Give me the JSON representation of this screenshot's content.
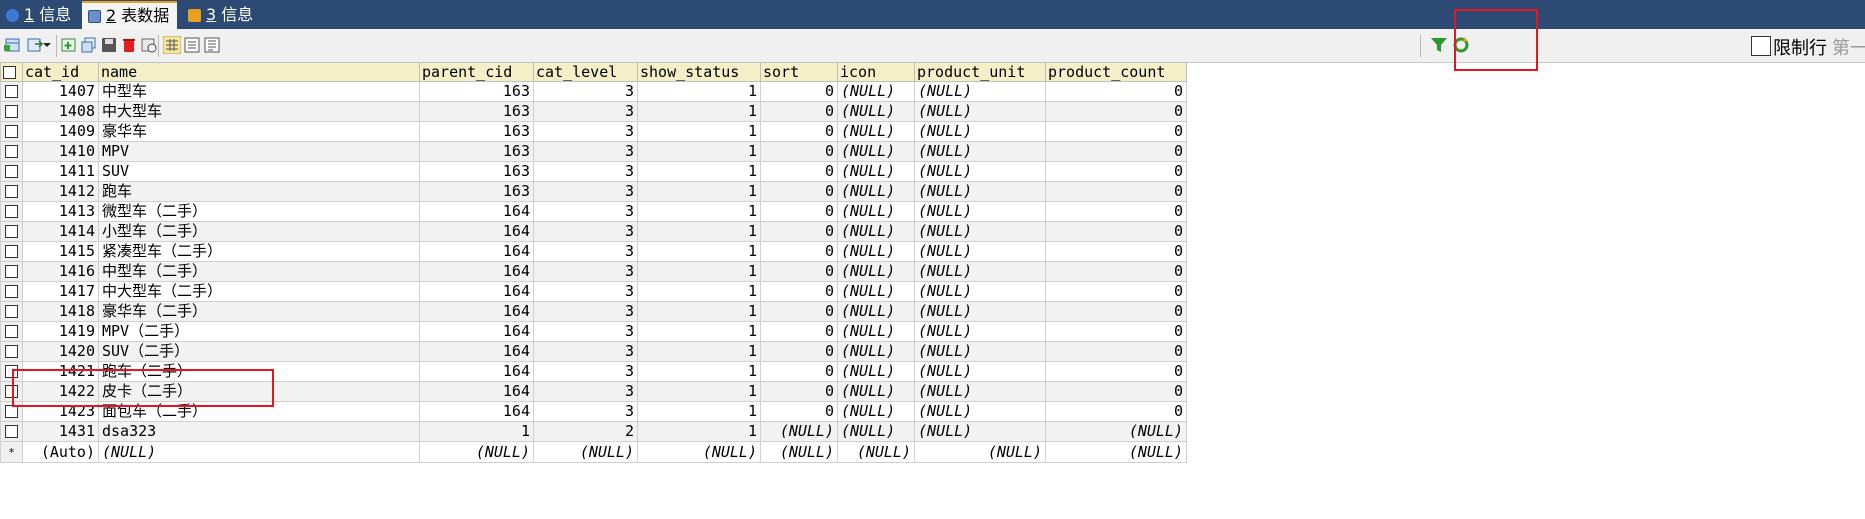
{
  "tabs": [
    {
      "num": "1",
      "label": "信息",
      "icon": "info-icon"
    },
    {
      "num": "2",
      "label": "表数据",
      "icon": "table-icon",
      "active": true
    },
    {
      "num": "3",
      "label": "信息",
      "icon": "info-icon"
    }
  ],
  "toolbar": {
    "limit_label": "限制行",
    "limit_label_next": "第一"
  },
  "grid": {
    "columns": [
      "cat_id",
      "name",
      "parent_cid",
      "cat_level",
      "show_status",
      "sort",
      "icon",
      "product_unit",
      "product_count"
    ],
    "rows": [
      [
        "1407",
        "中型车",
        "163",
        "3",
        "1",
        "0",
        "(NULL)",
        "(NULL)",
        "0"
      ],
      [
        "1408",
        "中大型车",
        "163",
        "3",
        "1",
        "0",
        "(NULL)",
        "(NULL)",
        "0"
      ],
      [
        "1409",
        "豪华车",
        "163",
        "3",
        "1",
        "0",
        "(NULL)",
        "(NULL)",
        "0"
      ],
      [
        "1410",
        "MPV",
        "163",
        "3",
        "1",
        "0",
        "(NULL)",
        "(NULL)",
        "0"
      ],
      [
        "1411",
        "SUV",
        "163",
        "3",
        "1",
        "0",
        "(NULL)",
        "(NULL)",
        "0"
      ],
      [
        "1412",
        "跑车",
        "163",
        "3",
        "1",
        "0",
        "(NULL)",
        "(NULL)",
        "0"
      ],
      [
        "1413",
        "微型车（二手）",
        "164",
        "3",
        "1",
        "0",
        "(NULL)",
        "(NULL)",
        "0"
      ],
      [
        "1414",
        "小型车（二手）",
        "164",
        "3",
        "1",
        "0",
        "(NULL)",
        "(NULL)",
        "0"
      ],
      [
        "1415",
        "紧凑型车（二手）",
        "164",
        "3",
        "1",
        "0",
        "(NULL)",
        "(NULL)",
        "0"
      ],
      [
        "1416",
        "中型车（二手）",
        "164",
        "3",
        "1",
        "0",
        "(NULL)",
        "(NULL)",
        "0"
      ],
      [
        "1417",
        "中大型车（二手）",
        "164",
        "3",
        "1",
        "0",
        "(NULL)",
        "(NULL)",
        "0"
      ],
      [
        "1418",
        "豪华车（二手）",
        "164",
        "3",
        "1",
        "0",
        "(NULL)",
        "(NULL)",
        "0"
      ],
      [
        "1419",
        "MPV（二手）",
        "164",
        "3",
        "1",
        "0",
        "(NULL)",
        "(NULL)",
        "0"
      ],
      [
        "1420",
        "SUV（二手）",
        "164",
        "3",
        "1",
        "0",
        "(NULL)",
        "(NULL)",
        "0"
      ],
      [
        "1421",
        "跑车（二手）",
        "164",
        "3",
        "1",
        "0",
        "(NULL)",
        "(NULL)",
        "0"
      ],
      [
        "1422",
        "皮卡（二手）",
        "164",
        "3",
        "1",
        "0",
        "(NULL)",
        "(NULL)",
        "0"
      ],
      [
        "1423",
        "面包车（二手）",
        "164",
        "3",
        "1",
        "0",
        "(NULL)",
        "(NULL)",
        "0"
      ],
      [
        "1431",
        "dsa323",
        "1",
        "2",
        "1",
        "(NULL)",
        "(NULL)",
        "(NULL)",
        "(NULL)"
      ]
    ],
    "new_row": {
      "marker": "*",
      "values": [
        "(Auto)",
        "(NULL)",
        "(NULL)",
        "(NULL)",
        "(NULL)",
        "(NULL)",
        "(NULL)",
        "(NULL)",
        "(NULL)"
      ]
    }
  },
  "colors": {
    "tabbar_bg": "#2c4a74",
    "header_bg": "#f5efc8",
    "highlight_box": "#e8141e"
  }
}
